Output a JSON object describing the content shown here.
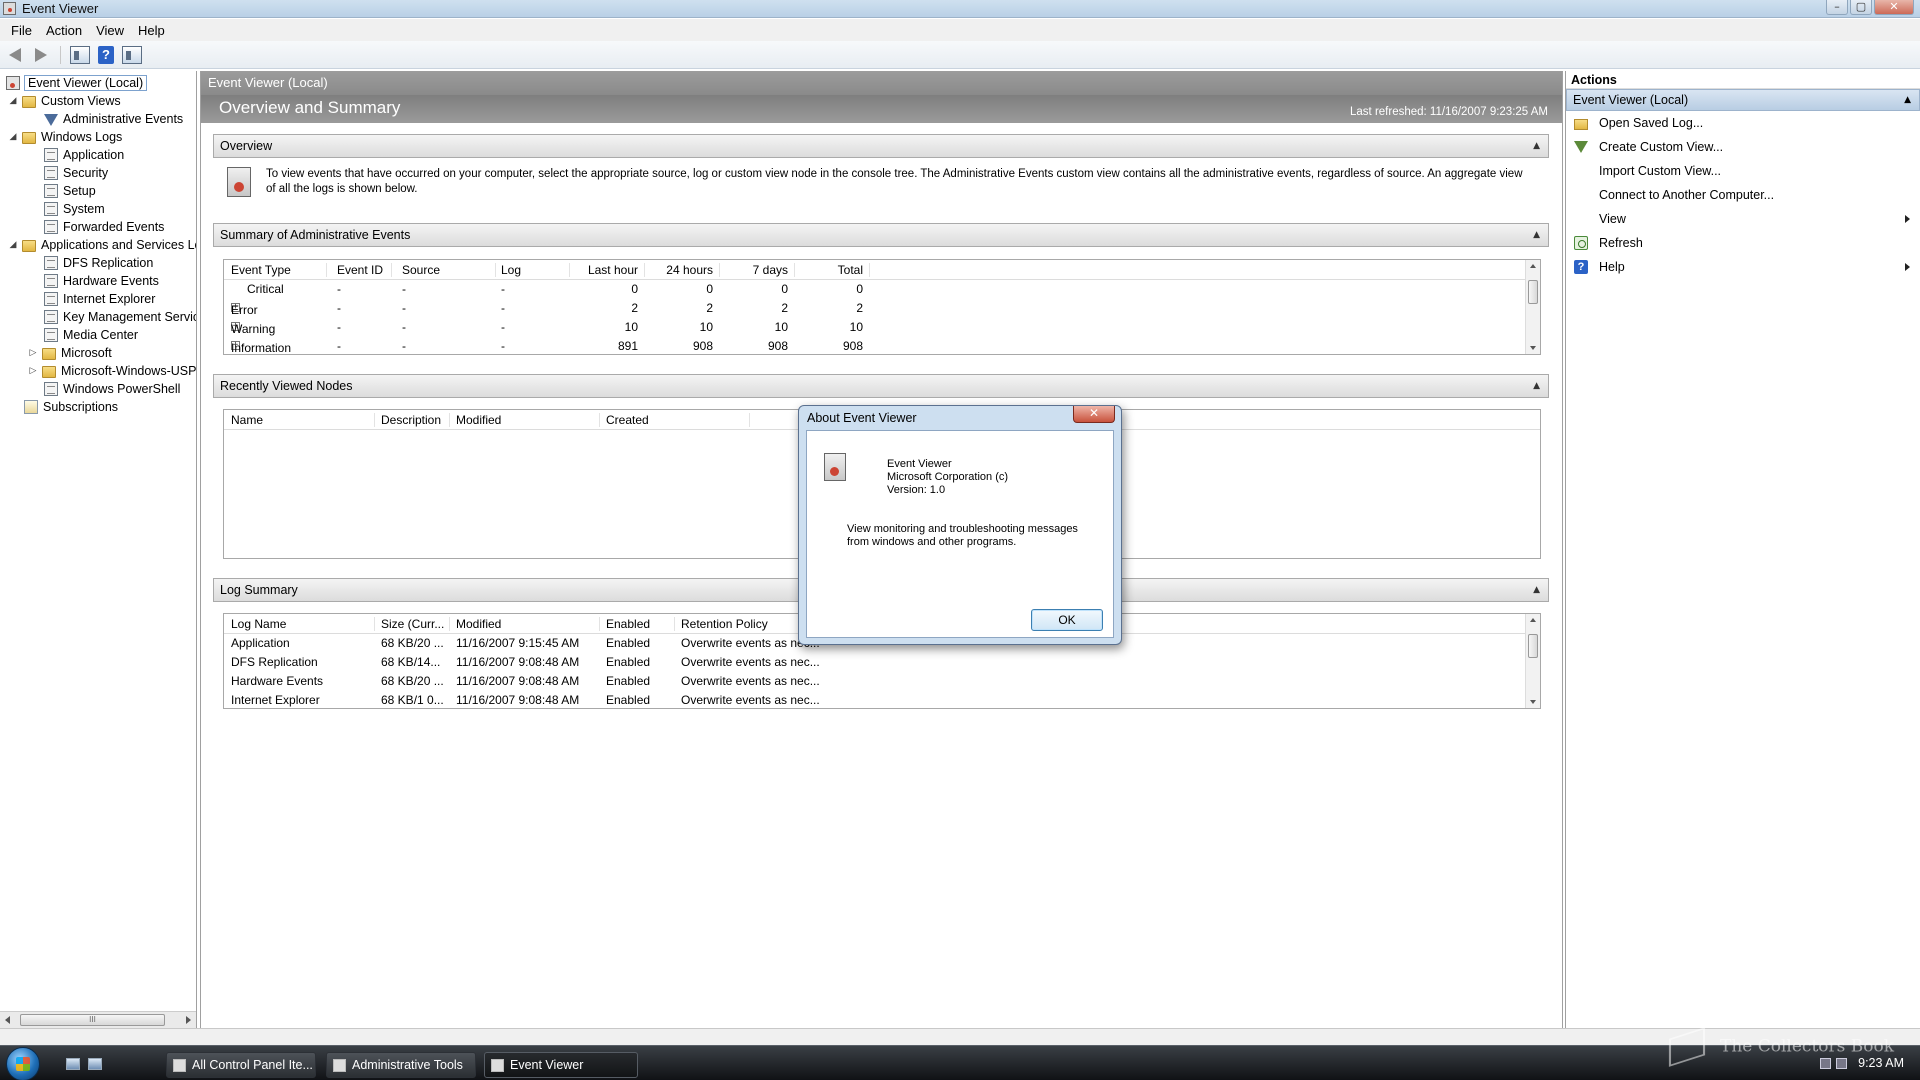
{
  "window": {
    "title": "Event Viewer",
    "min": "–",
    "max": "▢",
    "close": "✕"
  },
  "menu": [
    "File",
    "Action",
    "View",
    "Help"
  ],
  "toolbar": {
    "help_label": "?"
  },
  "tree": {
    "root": "Event Viewer (Local)",
    "custom_views": "Custom Views",
    "administrative_events": "Administrative Events",
    "windows_logs": "Windows Logs",
    "application": "Application",
    "security": "Security",
    "setup": "Setup",
    "system": "System",
    "forwarded_events": "Forwarded Events",
    "apps_services": "Applications and Services Lo",
    "dfs_replication": "DFS Replication",
    "hardware_events": "Hardware Events",
    "internet_explorer": "Internet Explorer",
    "key_management": "Key Management Service",
    "media_center": "Media Center",
    "microsoft": "Microsoft",
    "microsoft_windows_usp": "Microsoft-Windows-USP",
    "windows_powershell": "Windows PowerShell",
    "subscriptions": "Subscriptions",
    "scroll_grip": "III"
  },
  "center": {
    "header": "Event Viewer (Local)",
    "banner_title": "Overview and Summary",
    "last_refreshed": "Last refreshed: 11/16/2007 9:23:25 AM",
    "collapse_glyph": "▲",
    "overview": {
      "title": "Overview",
      "text": "To view events that have occurred on your computer, select the appropriate source, log or custom view node in the console tree. The Administrative Events custom view contains all the administrative events, regardless of source. An aggregate view of all the logs is shown below."
    },
    "summary": {
      "title": "Summary of Administrative Events",
      "columns": [
        "Event Type",
        "Event ID",
        "Source",
        "Log",
        "Last hour",
        "24 hours",
        "7 days",
        "Total"
      ],
      "rows": [
        {
          "type": "Critical",
          "id": "-",
          "source": "-",
          "log": "-",
          "last_hour": "0",
          "h24": "0",
          "d7": "0",
          "total": "0",
          "expand": ""
        },
        {
          "type": "Error",
          "id": "-",
          "source": "-",
          "log": "-",
          "last_hour": "2",
          "h24": "2",
          "d7": "2",
          "total": "2",
          "expand": "+"
        },
        {
          "type": "Warning",
          "id": "-",
          "source": "-",
          "log": "-",
          "last_hour": "10",
          "h24": "10",
          "d7": "10",
          "total": "10",
          "expand": "+"
        },
        {
          "type": "Information",
          "id": "-",
          "source": "-",
          "log": "-",
          "last_hour": "891",
          "h24": "908",
          "d7": "908",
          "total": "908",
          "expand": "+"
        }
      ]
    },
    "recent": {
      "title": "Recently Viewed Nodes",
      "columns": [
        "Name",
        "Description",
        "Modified",
        "Created"
      ]
    },
    "log_summary": {
      "title": "Log Summary",
      "columns": [
        "Log Name",
        "Size (Curr...",
        "Modified",
        "Enabled",
        "Retention Policy"
      ],
      "rows": [
        {
          "name": "Application",
          "size": "68 KB/20 ...",
          "modified": "11/16/2007 9:15:45 AM",
          "enabled": "Enabled",
          "retention": "Overwrite events as nec..."
        },
        {
          "name": "DFS Replication",
          "size": "68 KB/14...",
          "modified": "11/16/2007 9:08:48 AM",
          "enabled": "Enabled",
          "retention": "Overwrite events as nec..."
        },
        {
          "name": "Hardware Events",
          "size": "68 KB/20 ...",
          "modified": "11/16/2007 9:08:48 AM",
          "enabled": "Enabled",
          "retention": "Overwrite events as nec..."
        },
        {
          "name": "Internet Explorer",
          "size": "68 KB/1 0...",
          "modified": "11/16/2007 9:08:48 AM",
          "enabled": "Enabled",
          "retention": "Overwrite events as nec..."
        }
      ]
    }
  },
  "actions": {
    "title": "Actions",
    "section": "Event Viewer (Local)",
    "items": [
      "Open Saved Log...",
      "Create Custom View...",
      "Import Custom View...",
      "Connect to Another Computer...",
      "View",
      "Refresh",
      "Help"
    ],
    "help_glyph": "?"
  },
  "dialog": {
    "title": "About Event Viewer",
    "close": "✕",
    "product": "Event Viewer",
    "company": "Microsoft Corporation (c)",
    "version": "Version: 1.0",
    "description": "View monitoring and troubleshooting messages from windows and other programs.",
    "ok": "OK"
  },
  "taskbar": {
    "tasks": [
      "All Control Panel Ite...",
      "Administrative Tools",
      "Event Viewer"
    ],
    "clock": "9:23 AM"
  },
  "watermark": "The Collectors Book"
}
